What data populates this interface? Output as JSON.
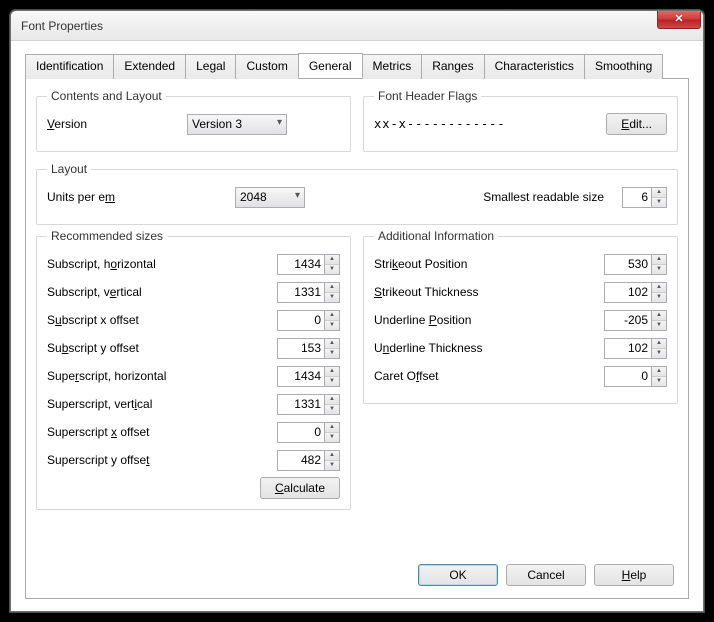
{
  "window": {
    "title": "Font Properties"
  },
  "tabs": [
    "Identification",
    "Extended",
    "Legal",
    "Custom",
    "General",
    "Metrics",
    "Ranges",
    "Characteristics",
    "Smoothing"
  ],
  "activeTab": "General",
  "contents": {
    "legend": "Contents and Layout",
    "versionLabel": "Version",
    "versionValue": "Version 3"
  },
  "headerFlags": {
    "legend": "Font Header Flags",
    "flags": "xx-x------------",
    "editLabel": "Edit..."
  },
  "layout": {
    "legend": "Layout",
    "unitsLabel": "Units per em",
    "unitsValue": "2048",
    "smallestLabel": "Smallest readable size",
    "smallestValue": "6"
  },
  "recommended": {
    "legend": "Recommended sizes",
    "rows": [
      {
        "label": "Subscript, horizontal",
        "value": "1434"
      },
      {
        "label": "Subscript, vertical",
        "value": "1331"
      },
      {
        "label": "Subscript x offset",
        "value": "0"
      },
      {
        "label": "Subscript y offset",
        "value": "153"
      },
      {
        "label": "Superscript, horizontal",
        "value": "1434"
      },
      {
        "label": "Superscript, vertical",
        "value": "1331"
      },
      {
        "label": "Superscript x offset",
        "value": "0"
      },
      {
        "label": "Superscript y offset",
        "value": "482"
      }
    ],
    "calculateLabel": "Calculate"
  },
  "additional": {
    "legend": "Additional Information",
    "rows": [
      {
        "label": "Strikeout Position",
        "value": "530"
      },
      {
        "label": "Strikeout Thickness",
        "value": "102"
      },
      {
        "label": "Underline Position",
        "value": "-205"
      },
      {
        "label": "Underline Thickness",
        "value": "102"
      },
      {
        "label": "Caret Offset",
        "value": "0"
      }
    ]
  },
  "buttons": {
    "ok": "OK",
    "cancel": "Cancel",
    "help": "Help"
  }
}
